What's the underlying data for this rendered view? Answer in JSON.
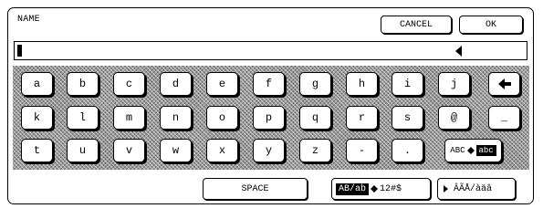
{
  "header": {
    "title": "NAME",
    "cancel_label": "CANCEL",
    "ok_label": "OK"
  },
  "input": {
    "value": ""
  },
  "keyboard": {
    "row1": [
      "a",
      "b",
      "c",
      "d",
      "e",
      "f",
      "g",
      "h",
      "i",
      "j"
    ],
    "row2": [
      "k",
      "l",
      "m",
      "n",
      "o",
      "p",
      "q",
      "r",
      "s",
      "@",
      "_"
    ],
    "row3": [
      "t",
      "u",
      "v",
      "w",
      "x",
      "y",
      "z",
      "-",
      "."
    ],
    "backspace_icon": "left-arrow-icon",
    "case_toggle": {
      "left": "ABC",
      "right": "abc"
    }
  },
  "bottom": {
    "space_label": "SPACE",
    "mode_left": "AB/ab",
    "mode_right": "12#$",
    "accent_label": "ÂÃÅ/àäâ"
  }
}
